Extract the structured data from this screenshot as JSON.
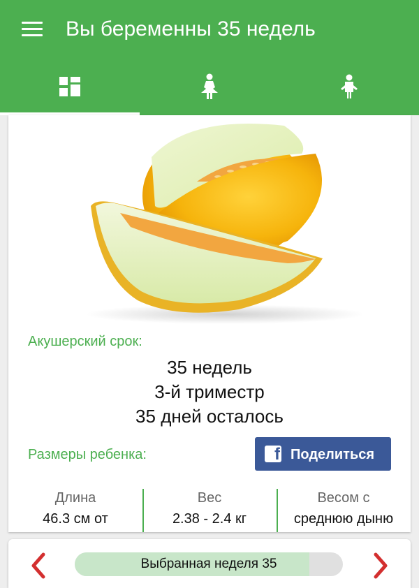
{
  "appbar": {
    "title": "Вы беременны 35 недель",
    "menu_icon": "hamburger-menu-icon",
    "background": "#4caf50"
  },
  "tabs": [
    {
      "icon": "dashboard-icon",
      "active": true
    },
    {
      "icon": "pregnant-woman-icon",
      "active": false
    },
    {
      "icon": "baby-icon",
      "active": false
    }
  ],
  "card": {
    "image": "melon-image",
    "term_label": "Акушерский срок:",
    "term_lines": [
      "35 недель",
      "3-й триместр",
      "35 дней осталось"
    ],
    "size_label": "Размеры ребенка:",
    "share_label": "Поделиться",
    "share_color": "#3b5998",
    "stats": [
      {
        "label": "Длина",
        "value": "46.3 см от"
      },
      {
        "label": "Вес",
        "value": "2.38 - 2.4 кг"
      },
      {
        "label": "Весом с",
        "value": "среднюю дыню"
      }
    ]
  },
  "bottom": {
    "week_label": "Выбранная неделя 35",
    "week_progress": 0.875,
    "prev_icon": "chevron-left-icon",
    "next_icon": "chevron-right-icon",
    "arrow_color": "#d32f2f"
  }
}
